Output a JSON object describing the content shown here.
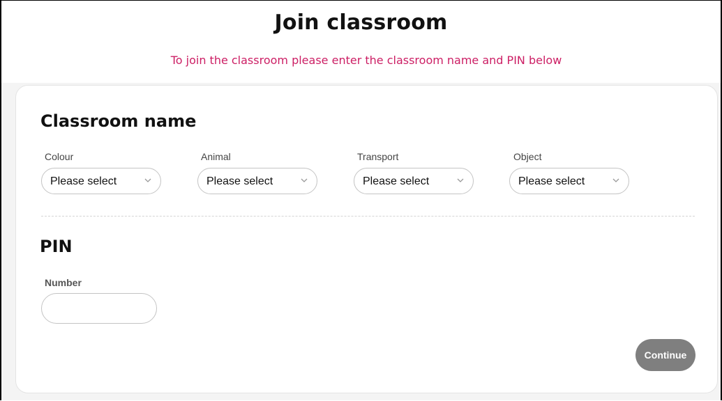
{
  "header": {
    "title": "Join classroom",
    "subtitle": "To join the classroom please enter the classroom name and PIN below"
  },
  "classroom_name": {
    "heading": "Classroom name",
    "fields": [
      {
        "label": "Colour",
        "value": "Please select",
        "icon": "chevron-down-icon"
      },
      {
        "label": "Animal",
        "value": "Please select",
        "icon": "chevron-down-icon"
      },
      {
        "label": "Transport",
        "value": "Please select",
        "icon": "chevron-down-icon"
      },
      {
        "label": "Object",
        "value": "Please select",
        "icon": "chevron-down-icon"
      }
    ]
  },
  "pin": {
    "heading": "PIN",
    "number_label": "Number",
    "number_value": ""
  },
  "actions": {
    "continue_label": "Continue"
  },
  "colors": {
    "accent_subtitle": "#cc1e64",
    "button_disabled": "#7f7f7f",
    "page_background": "#f4f4f4"
  }
}
